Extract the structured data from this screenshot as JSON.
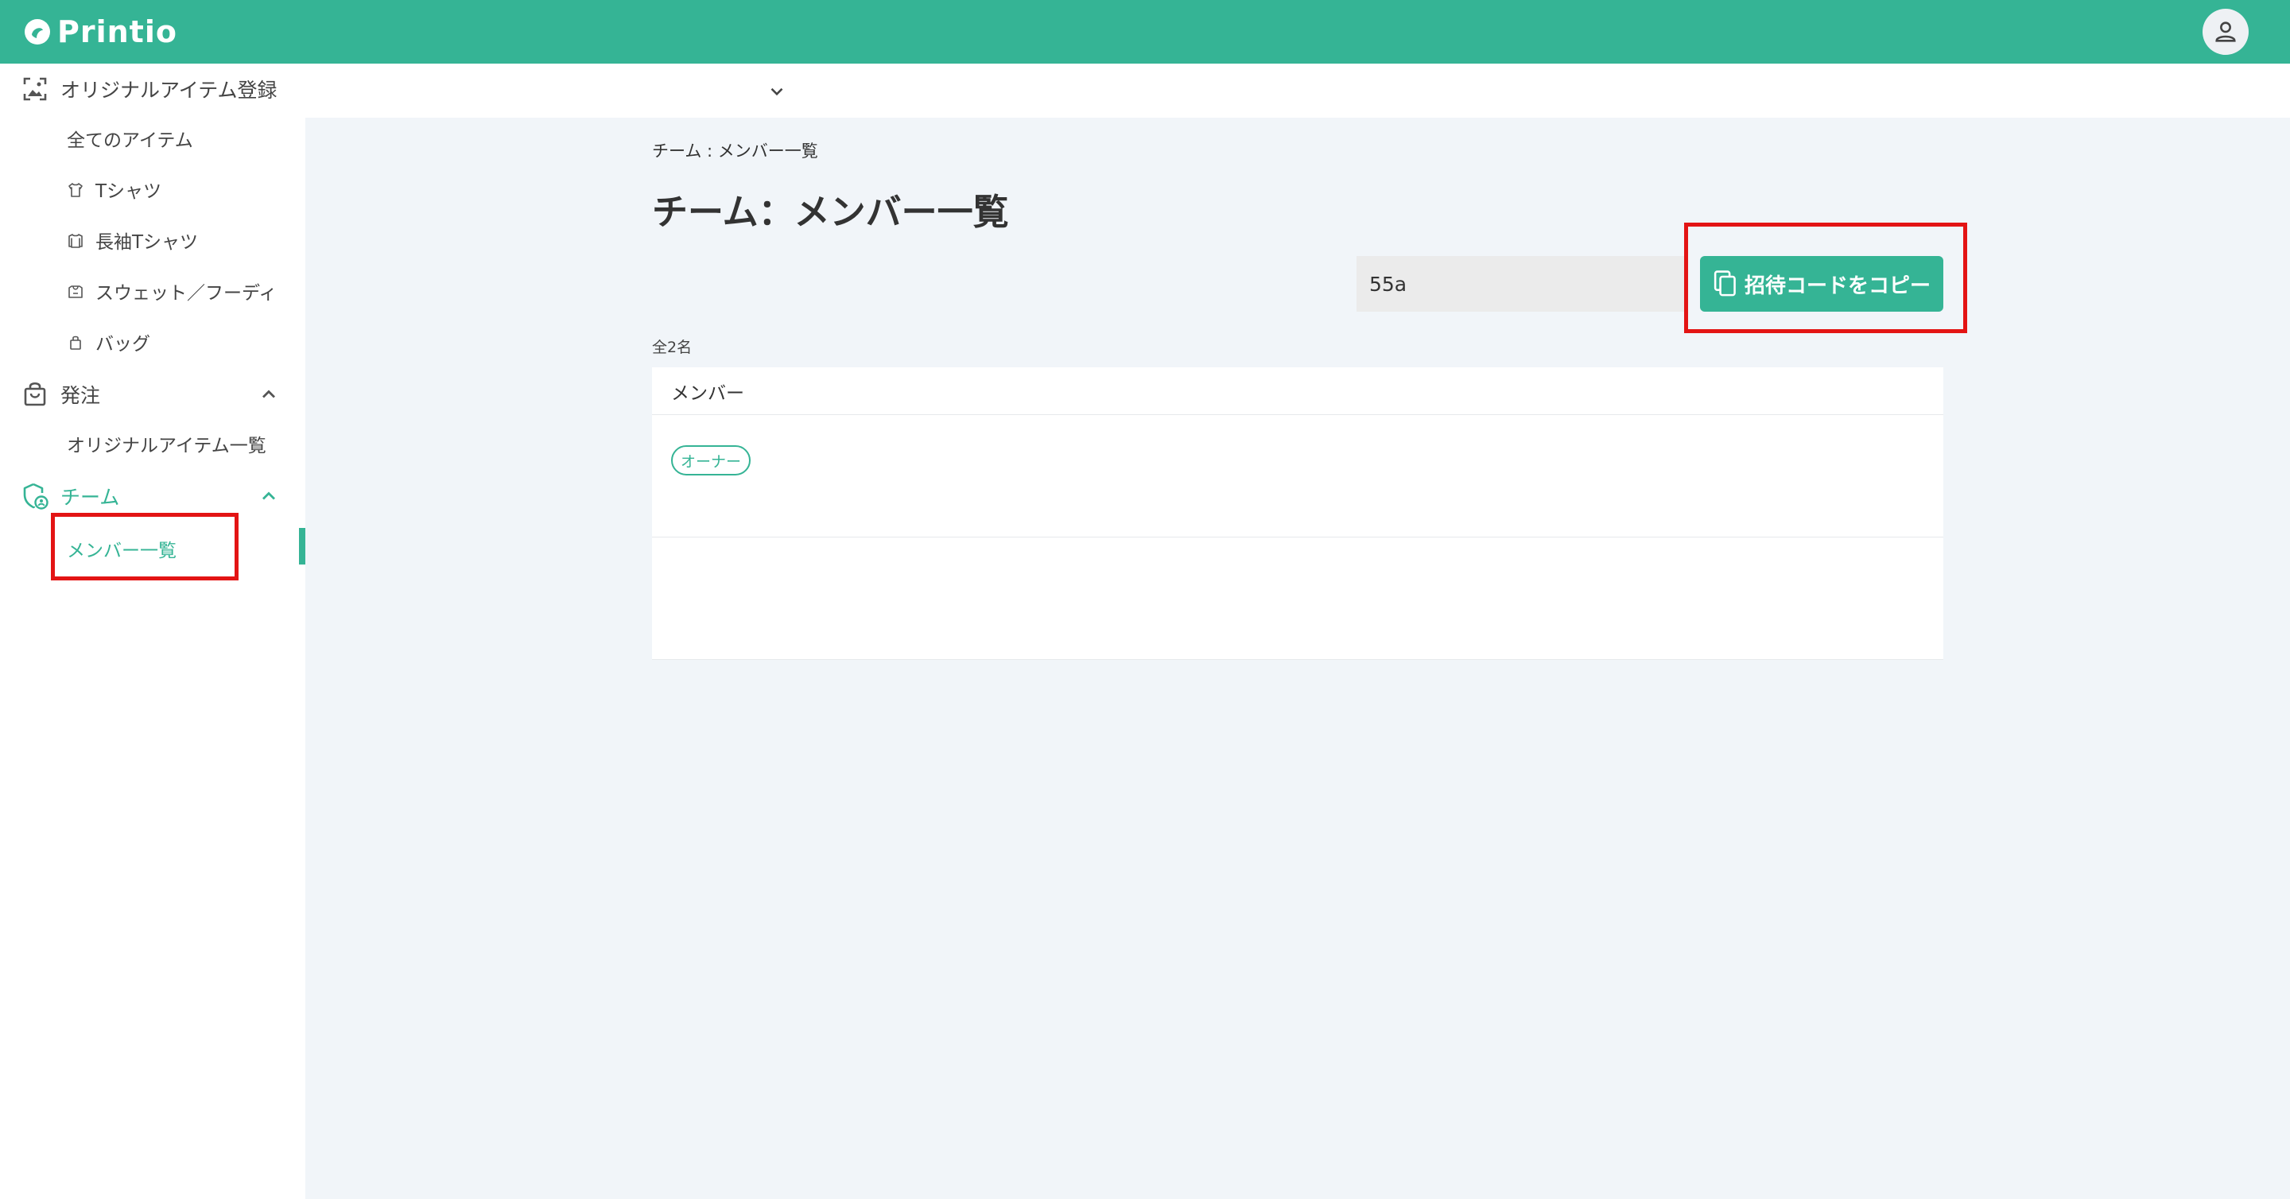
{
  "app": {
    "logo_text": "Printio",
    "brand_color": "#35b495"
  },
  "sidebar": {
    "groups": [
      {
        "label": "オリジナルアイテム登録",
        "icon": "image-upload-icon",
        "items": [
          {
            "label": "全てのアイテム"
          },
          {
            "label": "Tシャツ",
            "icon": "tshirt-icon"
          },
          {
            "label": "長袖Tシャツ",
            "icon": "longsleeve-icon"
          },
          {
            "label": "スウェット／フーディ",
            "icon": "hoodie-icon"
          },
          {
            "label": "バッグ",
            "icon": "bag-icon"
          }
        ]
      },
      {
        "label": "発注",
        "icon": "shopping-bag-icon",
        "items": [
          {
            "label": "オリジナルアイテム一覧"
          }
        ]
      },
      {
        "label": "チーム",
        "icon": "team-shield-icon",
        "items": [
          {
            "label": "メンバー一覧"
          }
        ]
      }
    ]
  },
  "main": {
    "breadcrumb": "チーム : メンバー一覧",
    "title": "チーム：メンバー一覧",
    "invite_code_value": "55a",
    "copy_button_label": "招待コードをコピー",
    "member_count": "全2名",
    "table": {
      "header": "メンバー",
      "rows": [
        {
          "badge": "オーナー"
        },
        {
          "badge": ""
        }
      ]
    }
  }
}
